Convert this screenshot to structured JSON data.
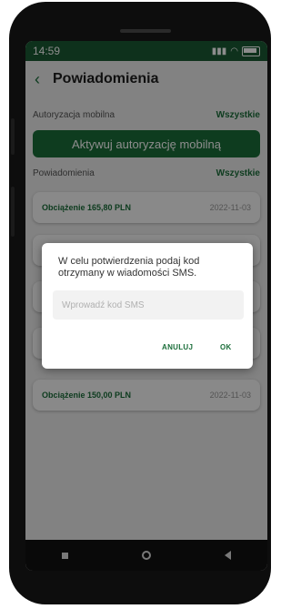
{
  "status_bar": {
    "time": "14:59"
  },
  "header": {
    "title": "Powiadomienia"
  },
  "mobile_auth": {
    "section_label": "Autoryzacja mobilna",
    "all_link": "Wszystkie",
    "activate_button": "Aktywuj autoryzację mobilną"
  },
  "notifications": {
    "section_label": "Powiadomienia",
    "all_link": "Wszystkie",
    "items": [
      {
        "amount": "Obciążenie 165,80 PLN",
        "date": "2022-11-03"
      },
      {
        "amount": "Obciążenie 150,00 PLN",
        "date": "2022-11-03"
      }
    ]
  },
  "dialog": {
    "message": "W celu potwierdzenia podaj kod otrzymany w wiadomości SMS.",
    "input_placeholder": "Wprowadź kod SMS",
    "cancel_button": "ANULUJ",
    "ok_button": "OK"
  },
  "colors": {
    "accent": "#1b6e3a",
    "status_bar": "#1b5a34",
    "phone_body": "#0d0d0d"
  }
}
